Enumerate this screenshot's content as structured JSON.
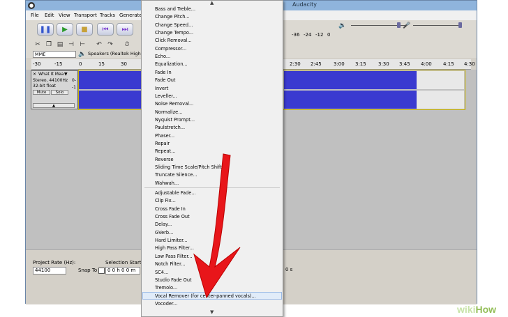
{
  "window": {
    "title": "Audacity",
    "icon": "audacity-icon"
  },
  "menubar": {
    "items": [
      "File",
      "Edit",
      "View",
      "Transport",
      "Tracks",
      "Generate"
    ]
  },
  "toolbar": {
    "pause_icon": "pause-icon",
    "play_icon": "play-icon",
    "stop_icon": "stop-icon",
    "skip_start_icon": "skip-start-icon",
    "skip_end_icon": "skip-end-icon",
    "meter_ticks": [
      "-36",
      "-24",
      "-12",
      "0"
    ],
    "host": "MME",
    "output_device": "Speakers (Realtek High Defi"
  },
  "ruler": {
    "left_ticks": [
      "-30",
      "-15",
      "0",
      "15",
      "30"
    ],
    "right_ticks": [
      "2:30",
      "2:45",
      "3:00",
      "3:15",
      "3:30",
      "3:45",
      "4:00",
      "4:15",
      "4:30"
    ]
  },
  "track": {
    "name": "What It Mea",
    "format": "Stereo, 44100Hz",
    "bitdepth": "32-bit float",
    "mute": "Mute",
    "solo": "Solo",
    "scale_top": "0-",
    "scale_bottom": "-1"
  },
  "selection": {
    "project_rate_label": "Project Rate (Hz):",
    "project_rate_value": "44100",
    "snap_label": "Snap To",
    "selection_start_label": "Selection Start:",
    "selection_start_value": "0 0 h 0 0 m",
    "end_suffix": "0 s"
  },
  "effect_menu": {
    "group1": [
      "Bass and Treble...",
      "Change Pitch...",
      "Change Speed...",
      "Change Tempo...",
      "Click Removal...",
      "Compressor...",
      "Echo...",
      "Equalization...",
      "Fade In",
      "Fade Out",
      "Invert",
      "Leveller...",
      "Noise Removal...",
      "Normalize...",
      "Nyquist Prompt...",
      "Paulstretch...",
      "Phaser...",
      "Repair",
      "Repeat...",
      "Reverse",
      "Sliding Time Scale/Pitch Shift...",
      "Truncate Silence...",
      "Wahwah..."
    ],
    "group2": [
      "Adjustable Fade...",
      "Clip Fix...",
      "Cross Fade In",
      "Cross Fade Out",
      "Delay...",
      "GVerb...",
      "Hard Limiter...",
      "High Pass Filter...",
      "Low Pass Filter...",
      "Notch Filter...",
      "SC4...",
      "Studio Fade Out",
      "Tremolo...",
      "Vocal Remover (for center-panned vocals)...",
      "Vocoder..."
    ],
    "highlighted": "Vocal Remover (for center-panned vocals)...",
    "scroll_up_icon": "chevron-up-icon",
    "scroll_down_icon": "chevron-down-icon"
  },
  "watermark": {
    "wiki": "wiki",
    "how": "How"
  },
  "colors": {
    "waveform": "#3a3ad0",
    "arrow": "#e8161a",
    "menu_highlight": "#e1ecf9"
  }
}
